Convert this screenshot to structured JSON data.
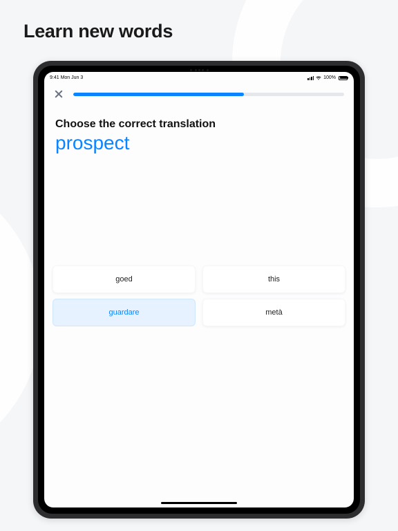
{
  "headline": "Learn new words",
  "status": {
    "time_date": "9:41 Mon Jun 3",
    "battery_pct": "100%"
  },
  "progress": {
    "percent": 63
  },
  "instruction": "Choose the correct translation",
  "word": "prospect",
  "options": [
    {
      "label": "goed",
      "selected": false
    },
    {
      "label": "this",
      "selected": false
    },
    {
      "label": "guardare",
      "selected": true
    },
    {
      "label": "metà",
      "selected": false
    }
  ],
  "colors": {
    "accent": "#0a84ff",
    "selected_bg": "#e6f2ff"
  }
}
